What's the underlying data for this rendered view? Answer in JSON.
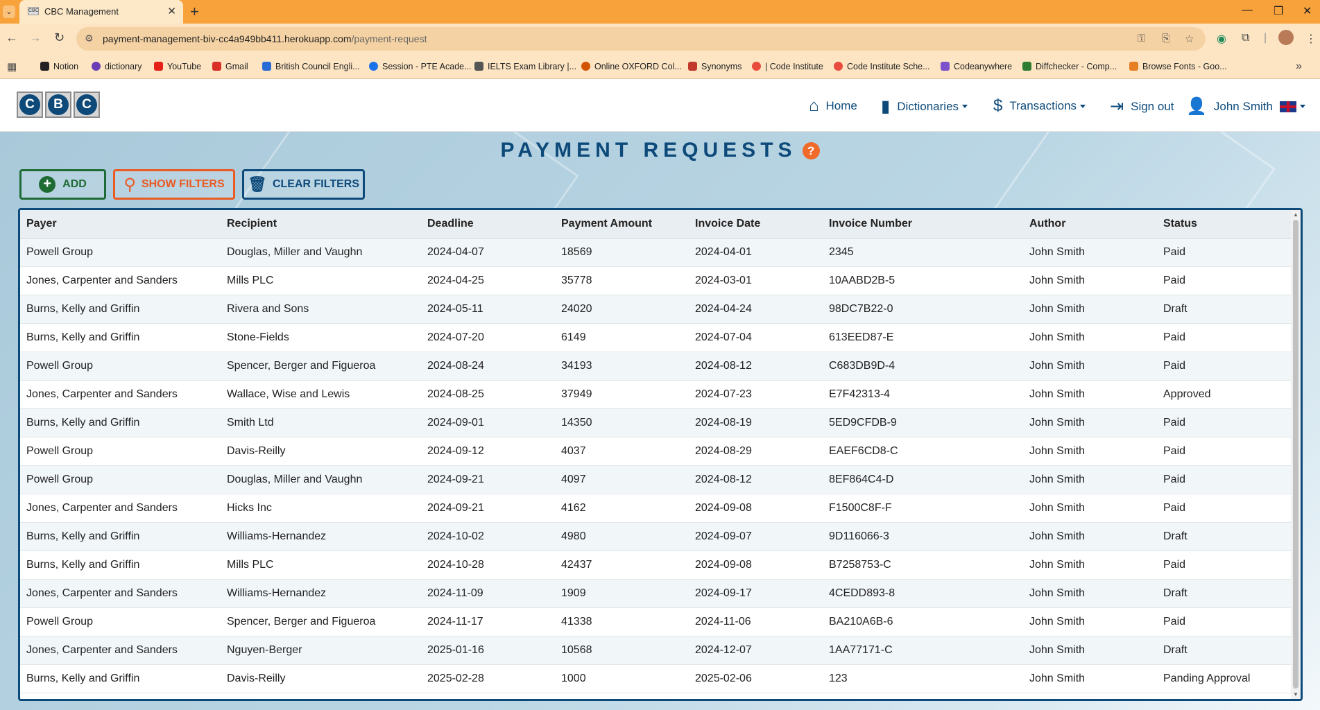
{
  "browser": {
    "tab_title": "CBC Management",
    "tab_favicon": "CBC",
    "url_domain": "payment-management-biv-cc4a949bb411.herokuapp.com",
    "url_path": "/payment-request",
    "bookmarks": [
      {
        "label": "Notion",
        "color": "#222222"
      },
      {
        "label": "dictionary",
        "color": "#6a3fb5"
      },
      {
        "label": "YouTube",
        "color": "#e62117"
      },
      {
        "label": "Gmail",
        "color": "#d93025"
      },
      {
        "label": "British Council Engli...",
        "color": "#2a6cd6"
      },
      {
        "label": "Session - PTE Acade...",
        "color": "#1a73e8"
      },
      {
        "label": "IELTS Exam Library |...",
        "color": "#555555"
      },
      {
        "label": "Online OXFORD Col...",
        "color": "#d35400"
      },
      {
        "label": "Synonyms",
        "color": "#c0392b"
      },
      {
        "label": "| Code Institute",
        "color": "#e74c3c"
      },
      {
        "label": "Code Institute Sche...",
        "color": "#e74c3c"
      },
      {
        "label": "Codeanywhere",
        "color": "#7b52c9"
      },
      {
        "label": "Diffchecker - Comp...",
        "color": "#2e7d32"
      },
      {
        "label": "Browse Fonts - Goo...",
        "color": "#e67e22"
      }
    ]
  },
  "nav": {
    "home": "Home",
    "dictionaries": "Dictionaries",
    "transactions": "Transactions",
    "signout": "Sign out",
    "user": "John Smith",
    "logo_letters": [
      "C",
      "B",
      "C"
    ]
  },
  "page": {
    "title": "PAYMENT REQUESTS",
    "help": "?"
  },
  "buttons": {
    "add": "ADD",
    "show_filters": "SHOW FILTERS",
    "clear_filters": "CLEAR FILTERS"
  },
  "table": {
    "columns": [
      "Payer",
      "Recipient",
      "Deadline",
      "Payment Amount",
      "Invoice Date",
      "Invoice Number",
      "Author",
      "Status"
    ],
    "rows": [
      [
        "Powell Group",
        "Douglas, Miller and Vaughn",
        "2024-04-07",
        "18569",
        "2024-04-01",
        "2345",
        "John Smith",
        "Paid"
      ],
      [
        "Jones, Carpenter and Sanders",
        "Mills PLC",
        "2024-04-25",
        "35778",
        "2024-03-01",
        "10AABD2B-5",
        "John Smith",
        "Paid"
      ],
      [
        "Burns, Kelly and Griffin",
        "Rivera and Sons",
        "2024-05-11",
        "24020",
        "2024-04-24",
        "98DC7B22-0",
        "John Smith",
        "Draft"
      ],
      [
        "Burns, Kelly and Griffin",
        "Stone-Fields",
        "2024-07-20",
        "6149",
        "2024-07-04",
        "613EED87-E",
        "John Smith",
        "Paid"
      ],
      [
        "Powell Group",
        "Spencer, Berger and Figueroa",
        "2024-08-24",
        "34193",
        "2024-08-12",
        "C683DB9D-4",
        "John Smith",
        "Paid"
      ],
      [
        "Jones, Carpenter and Sanders",
        "Wallace, Wise and Lewis",
        "2024-08-25",
        "37949",
        "2024-07-23",
        "E7F42313-4",
        "John Smith",
        "Approved"
      ],
      [
        "Burns, Kelly and Griffin",
        "Smith Ltd",
        "2024-09-01",
        "14350",
        "2024-08-19",
        "5ED9CFDB-9",
        "John Smith",
        "Paid"
      ],
      [
        "Powell Group",
        "Davis-Reilly",
        "2024-09-12",
        "4037",
        "2024-08-29",
        "EAEF6CD8-C",
        "John Smith",
        "Paid"
      ],
      [
        "Powell Group",
        "Douglas, Miller and Vaughn",
        "2024-09-21",
        "4097",
        "2024-08-12",
        "8EF864C4-D",
        "John Smith",
        "Paid"
      ],
      [
        "Jones, Carpenter and Sanders",
        "Hicks Inc",
        "2024-09-21",
        "4162",
        "2024-09-08",
        "F1500C8F-F",
        "John Smith",
        "Paid"
      ],
      [
        "Burns, Kelly and Griffin",
        "Williams-Hernandez",
        "2024-10-02",
        "4980",
        "2024-09-07",
        "9D116066-3",
        "John Smith",
        "Draft"
      ],
      [
        "Burns, Kelly and Griffin",
        "Mills PLC",
        "2024-10-28",
        "42437",
        "2024-09-08",
        "B7258753-C",
        "John Smith",
        "Paid"
      ],
      [
        "Jones, Carpenter and Sanders",
        "Williams-Hernandez",
        "2024-11-09",
        "1909",
        "2024-09-17",
        "4CEDD893-8",
        "John Smith",
        "Draft"
      ],
      [
        "Powell Group",
        "Spencer, Berger and Figueroa",
        "2024-11-17",
        "41338",
        "2024-11-06",
        "BA210A6B-6",
        "John Smith",
        "Paid"
      ],
      [
        "Jones, Carpenter and Sanders",
        "Nguyen-Berger",
        "2025-01-16",
        "10568",
        "2024-12-07",
        "1AA77171-C",
        "John Smith",
        "Draft"
      ],
      [
        "Burns, Kelly and Griffin",
        "Davis-Reilly",
        "2025-02-28",
        "1000",
        "2025-02-06",
        "123",
        "John Smith",
        "Panding Approval"
      ]
    ]
  },
  "colors": {
    "primary": "#0d4a7a",
    "add": "#1e6b34",
    "filter": "#ea5a23",
    "chrome": "#f7a23b"
  }
}
